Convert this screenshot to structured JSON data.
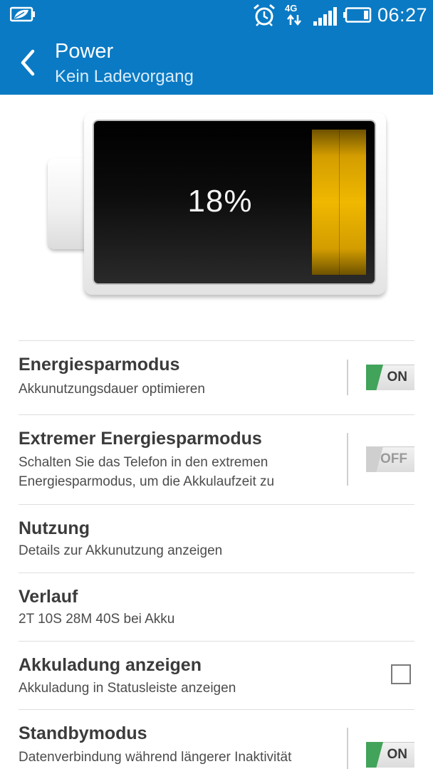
{
  "status_bar": {
    "left_icon": "leaf-battery-saver-icon",
    "alarm_icon": "alarm-clock-icon",
    "network_label": "4G",
    "signal_icon": "signal-bars-icon",
    "battery_icon": "battery-status-icon",
    "time": "06:27"
  },
  "header": {
    "back_icon": "back-arrow-icon",
    "title": "Power",
    "subtitle": "Kein Ladevorgang",
    "color": "#0a7ac4"
  },
  "battery": {
    "percent_label": "18%",
    "level": 0.18,
    "fill_color": "#f0b800"
  },
  "settings": [
    {
      "title": "Energiesparmodus",
      "summary": "Akkunutzungsdauer optimieren",
      "control": "toggle",
      "state_label": "ON"
    },
    {
      "title": "Extremer Energiesparmodus",
      "summary": "Schalten Sie das Telefon in den extremen Energiesparmodus, um die Akkulaufzeit zu",
      "control": "toggle",
      "state_label": "OFF"
    },
    {
      "title": "Nutzung",
      "summary": "Details zur Akkunutzung anzeigen"
    },
    {
      "title": "Verlauf",
      "summary": "2T 10S 28M 40S bei Akku"
    },
    {
      "title": "Akkuladung anzeigen",
      "summary": "Akkuladung in Statusleiste anzeigen",
      "control": "checkbox",
      "checked": false
    },
    {
      "title": "Standbymodus",
      "summary": "Datenverbindung während längerer Inaktivität deaktivieren",
      "control": "toggle",
      "state_label": "ON"
    }
  ],
  "accent_green": "#42a35a"
}
